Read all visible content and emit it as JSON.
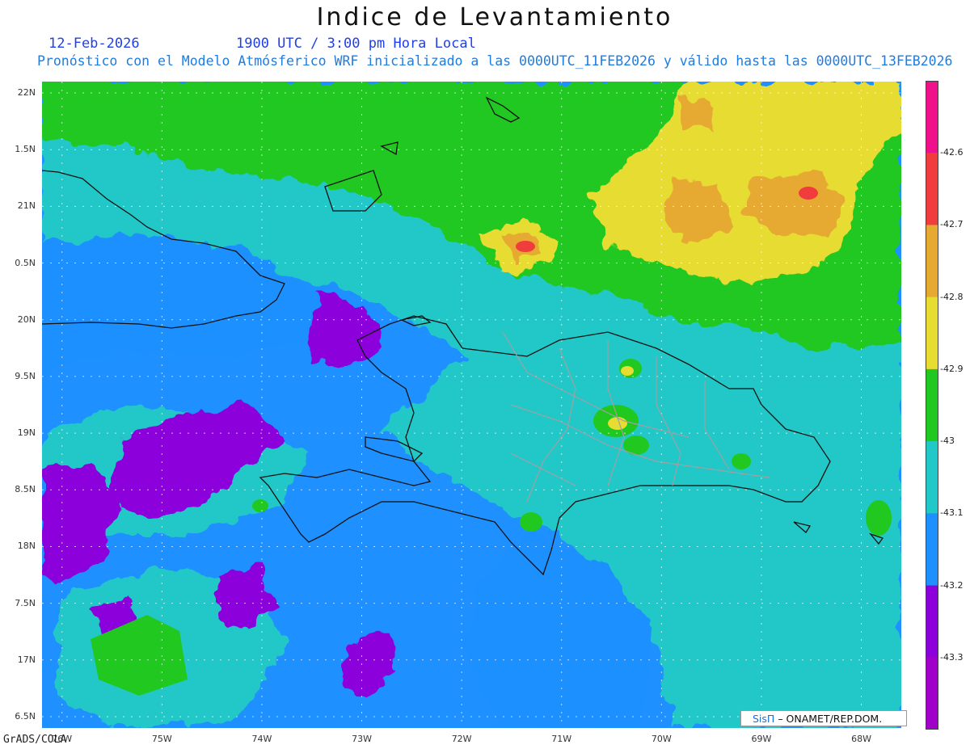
{
  "header": {
    "title": "Indice de Levantamiento",
    "date": "12-Feb-2026",
    "time": "1900 UTC / 3:00 pm Hora Local",
    "model_line": "Pronóstico con el Modelo Atmósferico WRF inicializado a las 0000UTC_11FEB2026 y válido hasta las  0000UTC_13FEB2026"
  },
  "map": {
    "lat_labels": [
      "22N",
      "1.5N",
      "21N",
      "0.5N",
      "20N",
      "9.5N",
      "19N",
      "8.5N",
      "18N",
      "7.5N",
      "17N",
      "6.5N"
    ],
    "lat_values": [
      22,
      21.5,
      21,
      20.5,
      20,
      19.5,
      19,
      18.5,
      18,
      17.5,
      17,
      16.5
    ],
    "lon_labels": [
      "76W",
      "75W",
      "74W",
      "73W",
      "72W",
      "71W",
      "70W",
      "69W",
      "68W"
    ],
    "lon_values": [
      -76,
      -75,
      -74,
      -73,
      -72,
      -71,
      -70,
      -69,
      -68
    ],
    "lon_range": [
      -76.2,
      -67.6
    ],
    "lat_range": [
      16.4,
      22.1
    ],
    "grid": true
  },
  "colorbar": {
    "labels": [
      "-42.6",
      "-42.7",
      "-42.8",
      "-42.9",
      "-43",
      "-43.1",
      "-43.2",
      "-43.3"
    ],
    "colors": [
      "#f0108c",
      "#f03c3c",
      "#e6aa32",
      "#e6dc32",
      "#20c820",
      "#20c8c8",
      "#1e90ff",
      "#8c00dc",
      "#a000c8"
    ]
  },
  "footer": {
    "software": "GrADS/COLA",
    "credit_brand": "SisΠ",
    "credit_text": "– ONAMET/REP.DOM."
  }
}
